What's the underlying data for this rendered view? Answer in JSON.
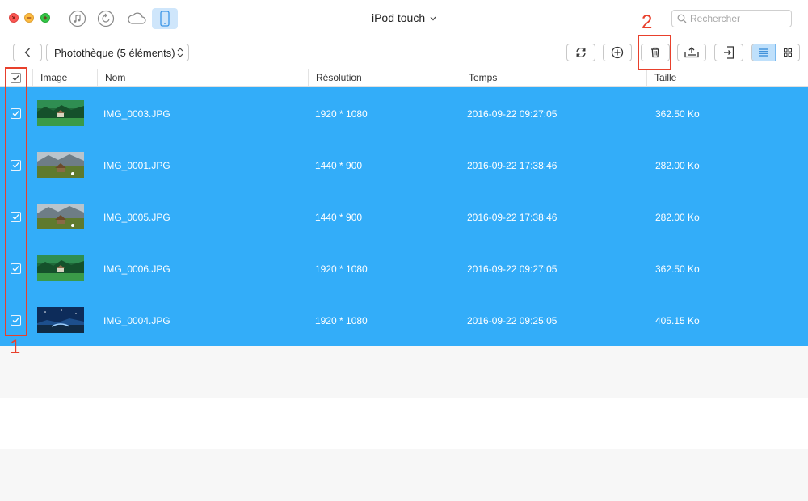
{
  "titlebar": {
    "device_name": "iPod touch",
    "search_placeholder": "Rechercher",
    "icons": [
      "music-icon",
      "restore-icon",
      "cloud-icon",
      "device-icon"
    ]
  },
  "toolbar": {
    "library_select": "Photothèque (5 éléments)",
    "view_mode": "list"
  },
  "table": {
    "columns": [
      "Image",
      "Nom",
      "Résolution",
      "Temps",
      "Taille"
    ],
    "select_all_checked": true,
    "rows": [
      {
        "name": "IMG_0003.JPG",
        "resolution": "1920 * 1080",
        "time": "2016-09-22 09:27:05",
        "size": "362.50 Ko",
        "checked": true,
        "thumb": "forest-green"
      },
      {
        "name": "IMG_0001.JPG",
        "resolution": "1440 * 900",
        "time": "2016-09-22 17:38:46",
        "size": "282.00 Ko",
        "checked": true,
        "thumb": "mountain-hut"
      },
      {
        "name": "IMG_0005.JPG",
        "resolution": "1440 * 900",
        "time": "2016-09-22 17:38:46",
        "size": "282.00 Ko",
        "checked": true,
        "thumb": "mountain-hut"
      },
      {
        "name": "IMG_0006.JPG",
        "resolution": "1920 * 1080",
        "time": "2016-09-22 09:27:05",
        "size": "362.50 Ko",
        "checked": true,
        "thumb": "forest-green"
      },
      {
        "name": "IMG_0004.JPG",
        "resolution": "1920 * 1080",
        "time": "2016-09-22 09:25:05",
        "size": "405.15 Ko",
        "checked": true,
        "thumb": "night-sky"
      }
    ]
  },
  "annotations": {
    "step1": "1",
    "step2": "2"
  },
  "colors": {
    "selection": "#33adf9",
    "annotation": "#e8402c",
    "active_view": "#bfe0fb"
  }
}
